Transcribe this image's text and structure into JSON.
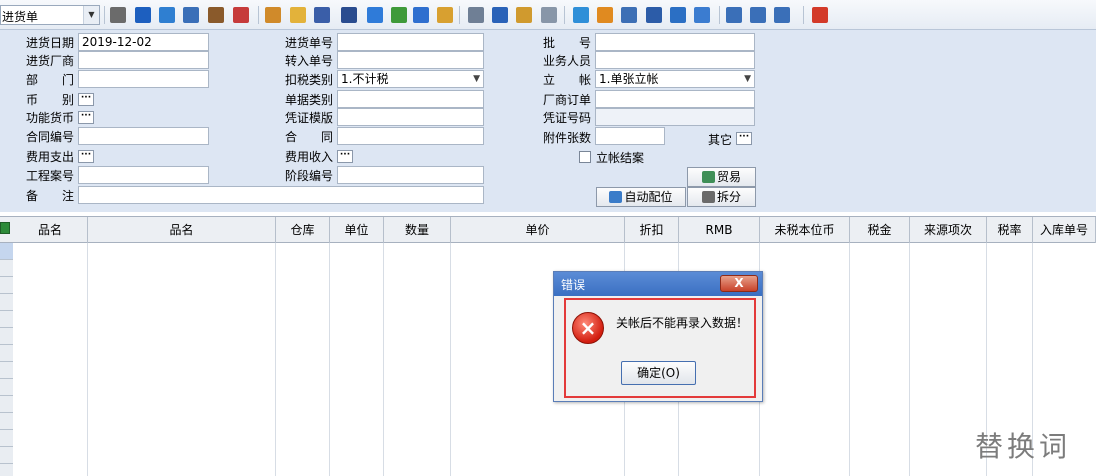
{
  "toolbar": {
    "bill_type": "进货单",
    "icons": [
      "merge-icon",
      "monitor-icon",
      "globe-icon",
      "user-lock-icon",
      "briefcase-icon",
      "rose-icon",
      "group-icon",
      "folder-open-icon",
      "star-icon",
      "key-icon",
      "help-icon",
      "dollar-icon",
      "cart-icon",
      "price-icon",
      "refresh-doc-icon",
      "list-icon",
      "layers-icon",
      "copy-icon",
      "check-icon",
      "bell-icon",
      "zoom-doc-icon",
      "tree-icon",
      "monitor-arrow-icon",
      "recycle-icon",
      "window-icon",
      "close-window-icon",
      "restore-window-icon",
      "exit-icon"
    ]
  },
  "form": {
    "date_label": "进货日期",
    "date_value": "2019-12-02",
    "supplier_label": "进货厂商",
    "dept_label": "部　　门",
    "currency_label": "币　　别",
    "func_currency_label": "功能货币",
    "contract_no_label": "合同编号",
    "expense_label": "费用支出",
    "project_label": "工程案号",
    "remark_label": "备　　注",
    "bill_no_label": "进货单号",
    "transfer_label": "转入单号",
    "tax_type_label": "扣税类别",
    "tax_type_value": "1.不计税",
    "doc_type_label": "单据类别",
    "voucher_tpl_label": "凭证模版",
    "contract_label": "合　　同",
    "income_label": "费用收入",
    "stage_label": "阶段编号",
    "batch_label": "批　　号",
    "salesman_label": "业务人员",
    "account_label": "立　　帐",
    "account_value": "1.单张立帐",
    "vendor_order_label": "厂商订单",
    "voucher_no_label": "凭证号码",
    "attach_label": "附件张数",
    "other_label": "其它",
    "close_account_label": "立帐结案",
    "trade_button": "贸易",
    "auto_match_button": "自动配位",
    "split_button": "拆分",
    "ellipsis": "···"
  },
  "grid": {
    "columns": [
      "品名",
      "品名",
      "仓库",
      "单位",
      "数量",
      "单价",
      "折扣",
      "RMB",
      "未税本位币",
      "税金",
      "来源项次",
      "税率",
      "入库单号"
    ]
  },
  "dialog": {
    "title": "错误",
    "close": "X",
    "message": "关帐后不能再录入数据！",
    "ok": "确定(O)"
  },
  "watermark": "替换词"
}
